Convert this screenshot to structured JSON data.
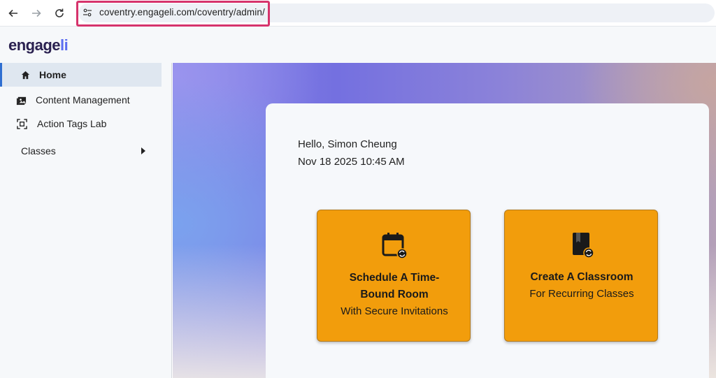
{
  "browser": {
    "url": "coventry.engageli.com/coventry/admin/"
  },
  "app": {
    "logo_main": "engage",
    "logo_accent": "li"
  },
  "sidebar": {
    "items": [
      {
        "label": "Home",
        "icon": "home-icon",
        "active": true
      },
      {
        "label": "Content Management",
        "icon": "media-library-icon",
        "active": false
      },
      {
        "label": "Action Tags Lab",
        "icon": "tag-scan-icon",
        "active": false
      },
      {
        "label": "Classes",
        "icon": "caret-right-icon",
        "active": false
      }
    ]
  },
  "welcome": {
    "greeting": "Hello, Simon Cheung",
    "datetime": "Nov 18 2025 10:45 AM"
  },
  "cards": [
    {
      "title_line1": "Schedule A Time-",
      "title_line2": "Bound Room",
      "subtitle": "With Secure Invitations",
      "icon": "calendar-sync-icon"
    },
    {
      "title_line1": "Create A Classroom",
      "subtitle": "For Recurring Classes",
      "icon": "book-sync-icon"
    }
  ],
  "colors": {
    "card_bg": "#f29d0c",
    "active_nav": "#2f6fd1",
    "url_highlight": "#d6336c"
  }
}
